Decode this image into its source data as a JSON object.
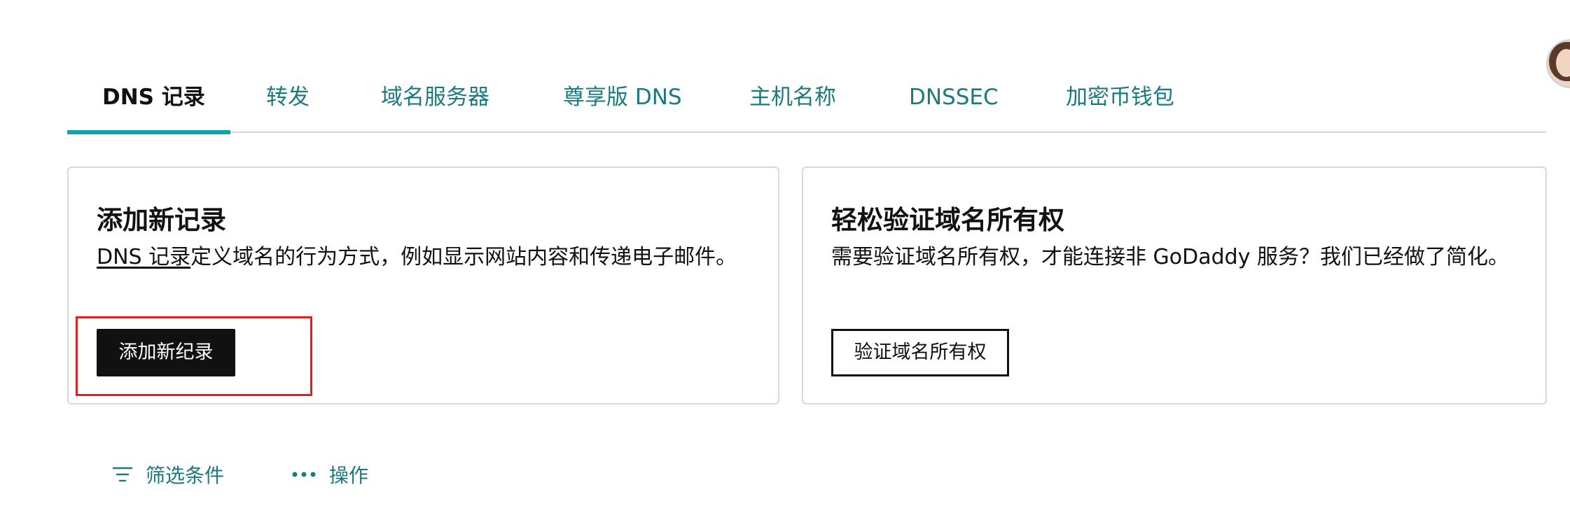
{
  "tabs": [
    {
      "label": "DNS 记录",
      "active": true
    },
    {
      "label": "转发",
      "active": false
    },
    {
      "label": "域名服务器",
      "active": false
    },
    {
      "label": "尊享版 DNS",
      "active": false
    },
    {
      "label": "主机名称",
      "active": false
    },
    {
      "label": "DNSSEC",
      "active": false
    },
    {
      "label": "加密币钱包",
      "active": false
    }
  ],
  "add_card": {
    "title": "添加新记录",
    "desc_link": "DNS 记录",
    "desc_text": "定义域名的行为方式，例如显示网站内容和传递电子邮件。",
    "button": "添加新纪录"
  },
  "verify_card": {
    "title": "轻松验证域名所有权",
    "desc": "需要验证域名所有权，才能连接非 GoDaddy 服务？我们已经做了简化。",
    "button": "验证域名所有权"
  },
  "actions": {
    "filter": "筛选条件",
    "operations": "操作"
  },
  "colors": {
    "accent": "#1a7a80",
    "tab_underline": "#14a3a8",
    "primary_button": "#111111",
    "highlight": "#e02020"
  },
  "icons": {
    "filter": "filter-icon",
    "more": "more-dots-icon",
    "avatar": "user-avatar"
  }
}
